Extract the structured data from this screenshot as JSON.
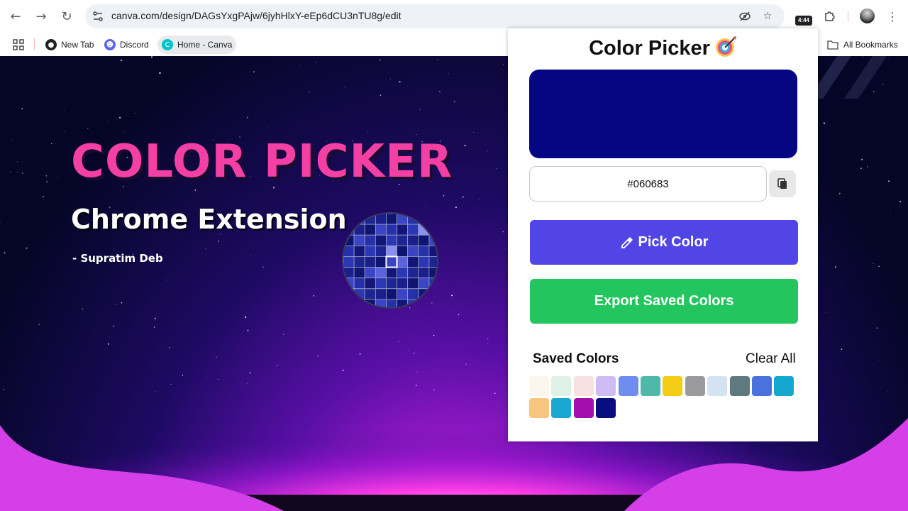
{
  "browser": {
    "url": "canva.com/design/DAGsYxgPAjw/6jyhHlxY-eEp6dCU3nTU8g/edit",
    "time_badge": "4:44",
    "bookmarks": [
      {
        "label": "New Tab",
        "icon": "globe-icon"
      },
      {
        "label": "Discord",
        "icon": "discord-icon",
        "color": "#5865f2"
      },
      {
        "label": "Home - Canva",
        "icon": "canva-icon",
        "color": "#00c4cc"
      }
    ],
    "all_bookmarks": "All Bookmarks"
  },
  "hero": {
    "title": "COLOR PICKER",
    "subtitle": "Chrome Extension",
    "author": "- Supratim Deb"
  },
  "popup": {
    "title": "Color Picker",
    "current_color": "#060683",
    "hex_value": "#060683",
    "pick_label": "Pick Color",
    "export_label": "Export Saved Colors",
    "saved_label": "Saved Colors",
    "clear_label": "Clear All",
    "saved_colors": [
      "#fcf6ee",
      "#dff0e6",
      "#f6e0e2",
      "#cdbdf4",
      "#6f8def",
      "#4fb8a8",
      "#f3cd16",
      "#9b9b9e",
      "#d3e3f2",
      "#5e7a80",
      "#4a72dd",
      "#14a8d0",
      "#f7c57d",
      "#1aa7d2",
      "#a20eb0",
      "#090d80"
    ],
    "accent_pick": "#5146e5",
    "accent_export": "#22c55e"
  }
}
